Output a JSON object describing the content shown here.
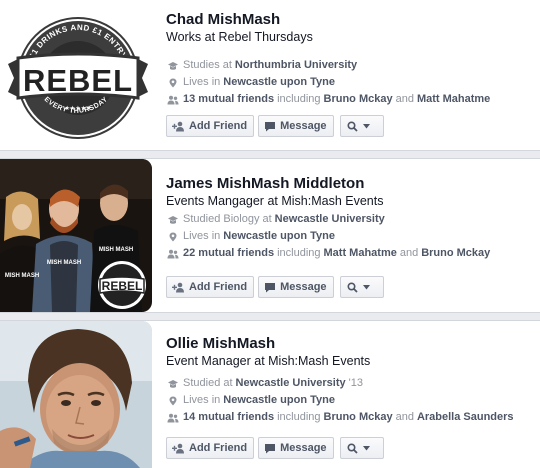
{
  "people": [
    {
      "name": "Chad MishMash",
      "subtitle": "Works at Rebel Thursdays",
      "education_prefix": "Studies at",
      "education_place": "Northumbria University",
      "lives_prefix": "Lives in",
      "lives_place": "Newcastle upon Tyne",
      "mutual_count": "13 mutual friends",
      "mutual_including": "including",
      "mutual_friend_1": "Bruno Mckay",
      "mutual_and": "and",
      "mutual_friend_2": "Matt Mahatme",
      "photo_text": {
        "logo": "REBEL",
        "ring_top": "£1 DRINKS AND £1 ENTRY",
        "ring_bottom": "EVERY THURSDAY",
        "stars": "★★★★★"
      }
    },
    {
      "name": "James MishMash Middleton",
      "subtitle": "Events Mangager at Mish:Mash Events",
      "education_prefix": "Studied Biology at",
      "education_place": "Newcastle University",
      "lives_prefix": "Lives in",
      "lives_place": "Newcastle upon Tyne",
      "mutual_count": "22 mutual friends",
      "mutual_including": "including",
      "mutual_friend_1": "Matt Mahatme",
      "mutual_and": "and",
      "mutual_friend_2": "Bruno Mckay",
      "photo_text": {
        "logo": "REBEL",
        "shirt_1": "MISH MASH",
        "shirt_2": "MISH MASH",
        "shirt_3": "MISH MASH"
      }
    },
    {
      "name": "Ollie MishMash",
      "subtitle": "Event Manager at Mish:Mash Events",
      "education_prefix": "Studied at",
      "education_place": "Newcastle University",
      "education_suffix": "'13",
      "lives_prefix": "Lives in",
      "lives_place": "Newcastle upon Tyne",
      "mutual_count": "14 mutual friends",
      "mutual_including": "including",
      "mutual_friend_1": "Bruno Mckay",
      "mutual_and": "and",
      "mutual_friend_2": "Arabella Saunders"
    }
  ],
  "buttons": {
    "add_friend": "Add Friend",
    "message": "Message"
  },
  "icons": {
    "education": "graduation-cap-icon",
    "lives": "location-pin-icon",
    "mutual": "people-icon",
    "add_friend": "add-friend-icon",
    "message": "message-bubble-icon",
    "search": "search-icon",
    "dropdown": "caret-down-icon"
  },
  "colors": {
    "name_text": "#141823",
    "fact_text": "#90949c",
    "fact_bold": "#4e5665",
    "separator": "#e9ebee",
    "button_border": "#cccfd6"
  }
}
